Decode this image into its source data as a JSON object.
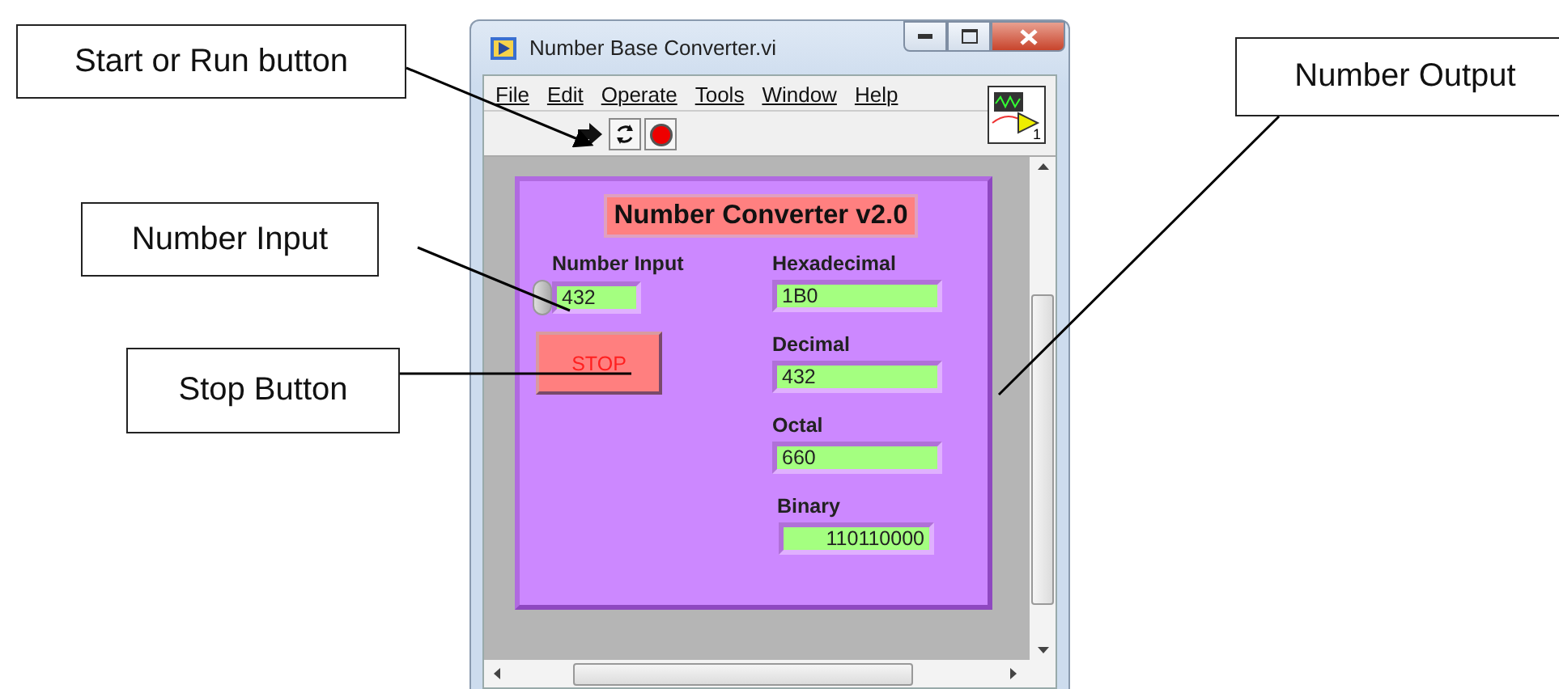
{
  "callouts": [
    {
      "text": "Start or Run button"
    },
    {
      "text": "Number Input"
    },
    {
      "text": "Stop Button"
    },
    {
      "text": "Number Output"
    }
  ],
  "window": {
    "title": "Number Base Converter.vi"
  },
  "menu": [
    "File",
    "Edit",
    "Operate",
    "Tools",
    "Window",
    "Help"
  ],
  "vi_icon": {
    "label": "1"
  },
  "panel": {
    "title": "Number Converter v2.0",
    "input": {
      "label": "Number Input",
      "value": "432"
    },
    "stop_button": {
      "label": "STOP"
    },
    "outputs": [
      {
        "label": "Hexadecimal",
        "value": "1B0",
        "kind": "string"
      },
      {
        "label": "Decimal",
        "value": "432",
        "kind": "string"
      },
      {
        "label": "Octal",
        "value": "660",
        "kind": "string"
      },
      {
        "label": "Binary",
        "value": "110110000",
        "kind": "numeric"
      }
    ]
  }
}
